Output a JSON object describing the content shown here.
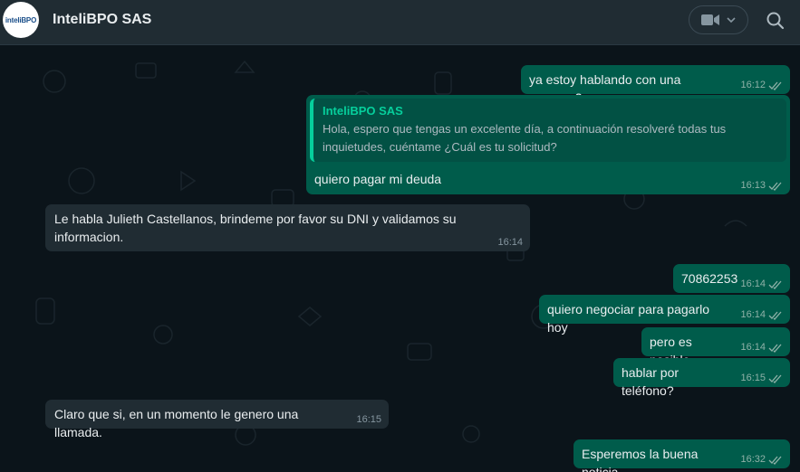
{
  "header": {
    "title": "InteliBPO SAS",
    "avatar_logo_text": "inteliBPO",
    "video_icon": "video-camera-icon",
    "dropdown_icon": "chevron-down-icon",
    "search_icon": "search-icon"
  },
  "colors": {
    "outgoing_bubble": "#005c4b",
    "incoming_bubble": "#202c33",
    "quote_accent": "#06cf9c",
    "background": "#0b141a"
  },
  "messages": [
    {
      "id": "m1",
      "direction": "out",
      "text": "ya estoy hablando con una persona?",
      "time": "16:12",
      "status": "read-ticks"
    },
    {
      "id": "m2",
      "direction": "out",
      "quote_author": "InteliBPO SAS",
      "quote_text": "Hola, espero que tengas un excelente día, a continuación resolveré  todas tus inquietudes, cuéntame ¿Cuál es tu solicitud?",
      "text": "quiero pagar mi deuda",
      "time": "16:13",
      "status": "read-ticks"
    },
    {
      "id": "m3",
      "direction": "in",
      "text": "Le habla Julieth Castellanos, brindeme por favor su DNI y validamos su informacion.",
      "time": "16:14"
    },
    {
      "id": "m4",
      "direction": "out",
      "text": "70862253",
      "time": "16:14",
      "status": "read-ticks"
    },
    {
      "id": "m5",
      "direction": "out",
      "text": "quiero negociar para pagarlo hoy",
      "time": "16:14",
      "status": "read-ticks"
    },
    {
      "id": "m6",
      "direction": "out",
      "text": "pero es posible",
      "time": "16:14",
      "status": "read-ticks"
    },
    {
      "id": "m7",
      "direction": "out",
      "text": "hablar por teléfono?",
      "time": "16:15",
      "status": "read-ticks"
    },
    {
      "id": "m8",
      "direction": "in",
      "text": "Claro que si, en un momento le genero una llamada.",
      "time": "16:15"
    },
    {
      "id": "m9",
      "direction": "out",
      "text": "Esperemos la buena noticia",
      "time": "16:32",
      "status": "read-ticks"
    }
  ]
}
